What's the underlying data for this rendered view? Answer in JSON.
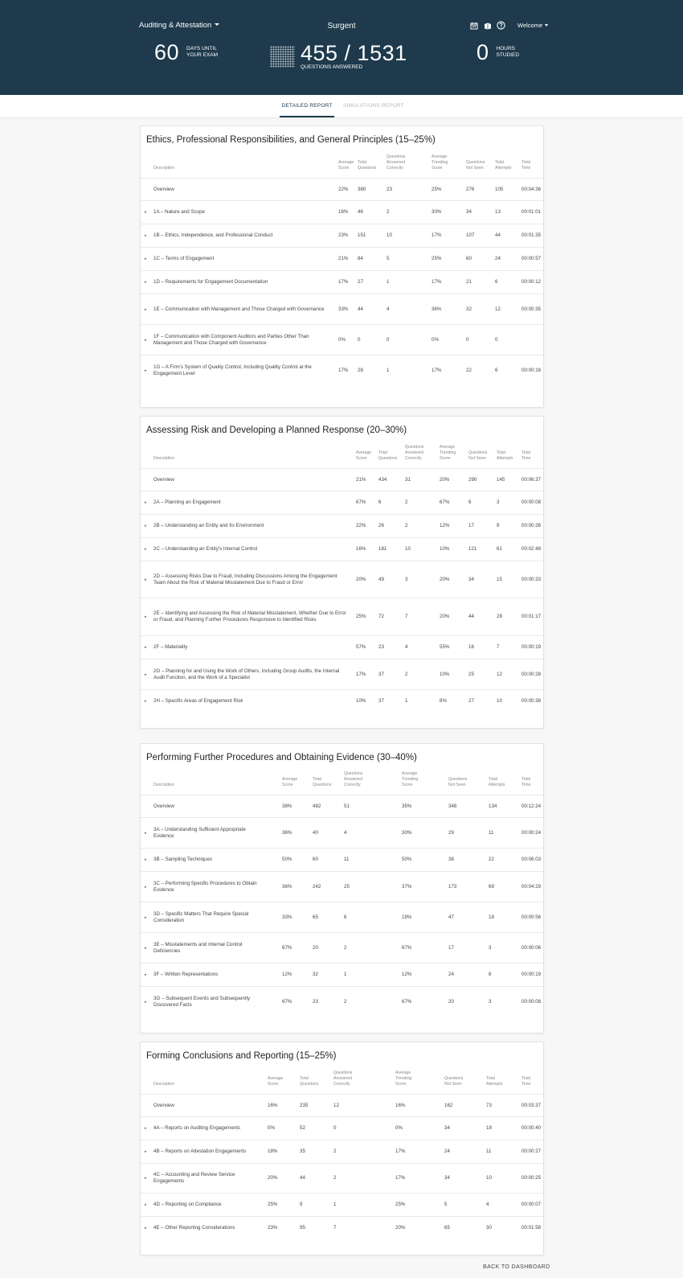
{
  "header": {
    "course": "Auditing & Attestation",
    "brand": "Surgent",
    "welcome": "Welcome",
    "days_value": "60",
    "days_label_1": "DAYS UNTIL",
    "days_label_2": "YOUR EXAM",
    "questions_value": "455 / 1531",
    "questions_label": "QUESTIONS ANSWERED",
    "hours_value": "0",
    "hours_label_1": "HOURS",
    "hours_label_2": "STUDIED",
    "icons": [
      "calendar-icon",
      "book-icon",
      "help-icon"
    ]
  },
  "tabs": {
    "detailed": "DETAILED REPORT",
    "simulations": "SIMULATIONS REPORT"
  },
  "columns": {
    "description": "Description",
    "avg_score": [
      "Average",
      "Score"
    ],
    "total_questions": [
      "Total",
      "Questions"
    ],
    "answered_correctly": [
      "Questions",
      "Answered",
      "Correctly"
    ],
    "avg_trending": [
      "Average",
      "Trending",
      "Score"
    ],
    "not_seen": [
      "Questions",
      "Not Seen"
    ],
    "total_attempts": [
      "Total",
      "Attempts"
    ],
    "total_time": [
      "Total",
      "Time"
    ]
  },
  "sections": [
    {
      "title": "Ethics, Professional Responsibilities, and General Principles (15–25%)",
      "rows": [
        [
          "",
          "Overview",
          "22%",
          "380",
          "23",
          "25%",
          "276",
          "105",
          "00:04:36"
        ],
        [
          "▸",
          "1A – Nature and Scope",
          "16%",
          "46",
          "2",
          "30%",
          "34",
          "13",
          "00:01:01"
        ],
        [
          "▸",
          "1B – Ethics, Independence, and Professional Conduct",
          "23%",
          "151",
          "10",
          "17%",
          "107",
          "44",
          "00:01:35"
        ],
        [
          "▸",
          "1C – Terms of Engagement",
          "21%",
          "84",
          "5",
          "25%",
          "60",
          "24",
          "00:00:57"
        ],
        [
          "▸",
          "1D – Requirements for Engagement Documentation",
          "17%",
          "27",
          "1",
          "17%",
          "21",
          "6",
          "00:00:12"
        ],
        [
          "▸",
          "1E – Communication with Management and Those Charged with Governance",
          "33%",
          "44",
          "4",
          "36%",
          "32",
          "12",
          "00:00:35"
        ],
        [
          "▸",
          "1F – Communication with Component Auditors and Parties Other Than Management and Those Charged with Governance",
          "0%",
          "0",
          "0",
          "0%",
          "0",
          "0",
          ""
        ],
        [
          "▸",
          "1G – A Firm's System of Quality Control, Including Quality Control at the Engagement Level",
          "17%",
          "28",
          "1",
          "17%",
          "22",
          "6",
          "00:00:16"
        ]
      ]
    },
    {
      "title": "Assessing Risk and Developing a Planned Response (20–30%)",
      "rows": [
        [
          "",
          "Overview",
          "21%",
          "434",
          "31",
          "20%",
          "290",
          "145",
          "00:06:37"
        ],
        [
          "▸",
          "2A – Planning an Engagement",
          "67%",
          "6",
          "2",
          "67%",
          "6",
          "3",
          "00:00:08"
        ],
        [
          "▸",
          "2B – Understanding an Entity and Its Environment",
          "22%",
          "26",
          "2",
          "12%",
          "17",
          "9",
          "00:00:26"
        ],
        [
          "▸",
          "2C – Understanding an Entity's Internal Control",
          "16%",
          "181",
          "10",
          "10%",
          "121",
          "61",
          "00:02:48"
        ],
        [
          "▸",
          "2D – Assessing Risks Due to Fraud, Including Discussions Among the Engagement Team About the Risk of Material Misstatement Due to Fraud or Error",
          "20%",
          "49",
          "3",
          "20%",
          "34",
          "15",
          "00:00:33"
        ],
        [
          "▸",
          "2E – Identifying and Assessing the Risk of Material Misstatement, Whether Due to Error or Fraud, and Planning Further Procedures Responsive to Identified Risks",
          "25%",
          "72",
          "7",
          "20%",
          "44",
          "28",
          "00:01:17"
        ],
        [
          "▸",
          "2F – Materiality",
          "57%",
          "23",
          "4",
          "55%",
          "16",
          "7",
          "00:00:19"
        ],
        [
          "▸",
          "2G – Planning for and Using the Work of Others, Including Group Audits, the Internal Audit Function, and the Work of a Specialist",
          "17%",
          "37",
          "2",
          "10%",
          "25",
          "12",
          "00:00:28"
        ],
        [
          "▸",
          "2H – Specific Areas of Engagement Risk",
          "10%",
          "37",
          "1",
          "8%",
          "27",
          "10",
          "00:00:38"
        ]
      ]
    },
    {
      "title": "Performing Further Procedures and Obtaining Evidence (30–40%)",
      "rows": [
        [
          "",
          "Overview",
          "38%",
          "482",
          "51",
          "35%",
          "348",
          "134",
          "00:12:24"
        ],
        [
          "▸",
          "3A – Understanding Sufficient Appropriate Evidence",
          "36%",
          "40",
          "4",
          "30%",
          "29",
          "11",
          "00:00:24"
        ],
        [
          "▸",
          "3B – Sampling Techniques",
          "50%",
          "60",
          "11",
          "50%",
          "38",
          "22",
          "00:06:03"
        ],
        [
          "▸",
          "3C – Performing Specific Procedures to Obtain Evidence",
          "36%",
          "242",
          "25",
          "37%",
          "173",
          "69",
          "00:04:29"
        ],
        [
          "▸",
          "3D – Specific Matters That Require Special Consideration",
          "33%",
          "65",
          "6",
          "19%",
          "47",
          "18",
          "00:00:56"
        ],
        [
          "▸",
          "3E – Misstatements and Internal Control Deficiencies",
          "67%",
          "20",
          "2",
          "67%",
          "17",
          "3",
          "00:00:06"
        ],
        [
          "▸",
          "3F – Written Representations",
          "12%",
          "32",
          "1",
          "12%",
          "24",
          "8",
          "00:00:19"
        ],
        [
          "▸",
          "3G – Subsequent Events and Subsequently Discovered Facts",
          "67%",
          "23",
          "2",
          "67%",
          "20",
          "3",
          "00:00:08"
        ]
      ]
    },
    {
      "title": "Forming Conclusions and Reporting (15–25%)",
      "rows": [
        [
          "",
          "Overview",
          "16%",
          "235",
          "12",
          "16%",
          "162",
          "73",
          "00:03:37"
        ],
        [
          "▸",
          "4A – Reports on Auditing Engagements",
          "0%",
          "52",
          "0",
          "0%",
          "34",
          "18",
          "00:00:40"
        ],
        [
          "▸",
          "4B – Reports on Attestation Engagements",
          "18%",
          "35",
          "2",
          "17%",
          "24",
          "11",
          "00:00:27"
        ],
        [
          "▸",
          "4C – Accounting and Review Service Engagements",
          "20%",
          "44",
          "2",
          "17%",
          "34",
          "10",
          "00:00:25"
        ],
        [
          "▸",
          "4D – Reporting on Compliance",
          "25%",
          "9",
          "1",
          "25%",
          "5",
          "4",
          "00:00:07"
        ],
        [
          "▸",
          "4E – Other Reporting Considerations",
          "23%",
          "95",
          "7",
          "20%",
          "65",
          "30",
          "00:01:58"
        ]
      ]
    }
  ],
  "footer": {
    "back_label": "BACK TO DASHBOARD"
  }
}
